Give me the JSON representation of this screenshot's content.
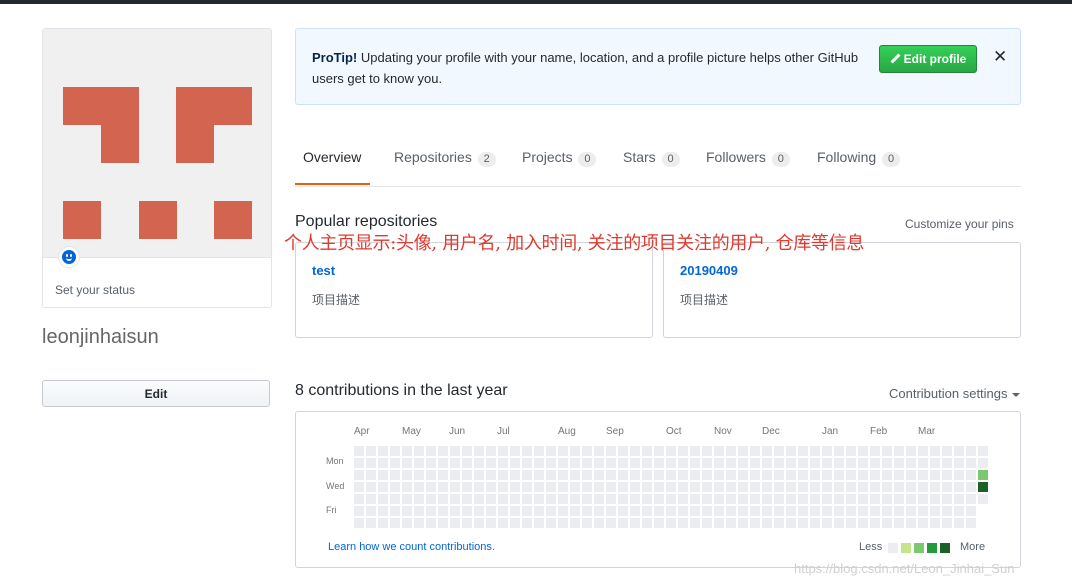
{
  "sidebar": {
    "status_text": "Set your status",
    "username": "leonjinhaisun",
    "edit_label": "Edit",
    "avatar_color": "#d26450"
  },
  "protip": {
    "label": "ProTip!",
    "text": "Updating your profile with your name, location, and a profile picture helps other GitHub users get to know you.",
    "button_label": "Edit profile",
    "close_glyph": "✕"
  },
  "tabs": [
    {
      "label": "Overview",
      "count": null
    },
    {
      "label": "Repositories",
      "count": "2"
    },
    {
      "label": "Projects",
      "count": "0"
    },
    {
      "label": "Stars",
      "count": "0"
    },
    {
      "label": "Followers",
      "count": "0"
    },
    {
      "label": "Following",
      "count": "0"
    }
  ],
  "popular": {
    "title": "Popular repositories",
    "customize": "Customize your pins",
    "annotation": "个人主页显示:头像, 用户名, 加入时间, 关注的项目关注的用户, 仓库等信息",
    "repos": [
      {
        "name": "test",
        "desc": "项目描述"
      },
      {
        "name": "20190409",
        "desc": "项目描述"
      }
    ]
  },
  "contributions": {
    "title": "8 contributions in the last year",
    "settings_label": "Contribution settings",
    "months": [
      "Apr",
      "May",
      "Jun",
      "Jul",
      "Aug",
      "Sep",
      "Oct",
      "Nov",
      "Dec",
      "Jan",
      "Feb",
      "Mar"
    ],
    "days": [
      "Mon",
      "Wed",
      "Fri"
    ],
    "learn_link": "Learn how we count contributions.",
    "legend_less": "Less",
    "legend_more": "More",
    "weeks": 53,
    "last_week_days": 5,
    "active_days": [
      {
        "week": 52,
        "day": 2,
        "level": 2
      },
      {
        "week": 52,
        "day": 3,
        "level": 4
      }
    ],
    "level_colors": [
      "#ebedf0",
      "#c6e48b",
      "#7bc96f",
      "#239a3b",
      "#196127"
    ]
  },
  "watermark": "https://blog.csdn.net/Leon_Jinhai_Sun"
}
